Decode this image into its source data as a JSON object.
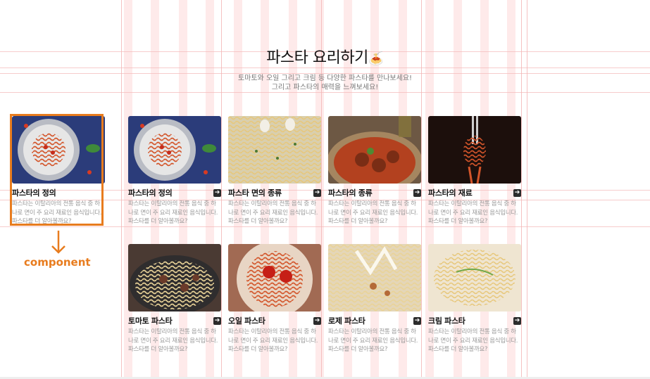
{
  "header": {
    "title": "파스타 요리하기",
    "title_emoji": "🍝",
    "desc_line1": "토마토와 오일 그리고 크림 등 다양한 파스타를 만나보세요!",
    "desc_line2": "그리고 파스타의 매력을 느껴보세요!"
  },
  "component_label": "component",
  "component_demo": {
    "name": "파스타의 정의",
    "text": "파스타는 이탈리아의 전통 음식 중 하나로 면이 주 요리 재료인 음식입니다. 파스타를 더 알아볼까요?"
  },
  "cards": [
    {
      "name": "파스타의 정의",
      "text": "파스타는 이탈리아의 전통 음식 중 하나로 면이 주 요리 재료인 음식입니다. 파스타를 더 알아볼까요?"
    },
    {
      "name": "파스타 면의 종류",
      "text": "파스타는 이탈리아의 전통 음식 중 하나로 면이 주 요리 재료인 음식입니다. 파스타를 더 알아볼까요?"
    },
    {
      "name": "파스타의 종류",
      "text": "파스타는 이탈리아의 전통 음식 중 하나로 면이 주 요리 재료인 음식입니다. 파스타를 더 알아볼까요?"
    },
    {
      "name": "파스타의 재료",
      "text": "파스타는 이탈리아의 전통 음식 중 하나로 면이 주 요리 재료인 음식입니다. 파스타를 더 알아볼까요?"
    },
    {
      "name": "토마토 파스타",
      "text": "파스타는 이탈리아의 전통 음식 중 하나로 면이 주 요리 재료인 음식입니다. 파스타를 더 알아볼까요?"
    },
    {
      "name": "오일 파스타",
      "text": "파스타는 이탈리아의 전통 음식 중 하나로 면이 주 요리 재료인 음식입니다. 파스타를 더 알아볼까요?"
    },
    {
      "name": "로제 파스타",
      "text": "파스타는 이탈리아의 전통 음식 중 하나로 면이 주 요리 재료인 음식입니다. 파스타를 더 알아볼까요?"
    },
    {
      "name": "크림 파스타",
      "text": "파스타는 이탈리아의 전통 음식 중 하나로 면이 주 요리 재료인 음식입니다. 파스타를 더 알아볼까요?"
    }
  ],
  "icons": {
    "card_link": "arrow-right-icon",
    "pointer": "arrow-down-icon"
  },
  "colors": {
    "accent": "#e87c1e",
    "guide": "#f3b7b7"
  }
}
